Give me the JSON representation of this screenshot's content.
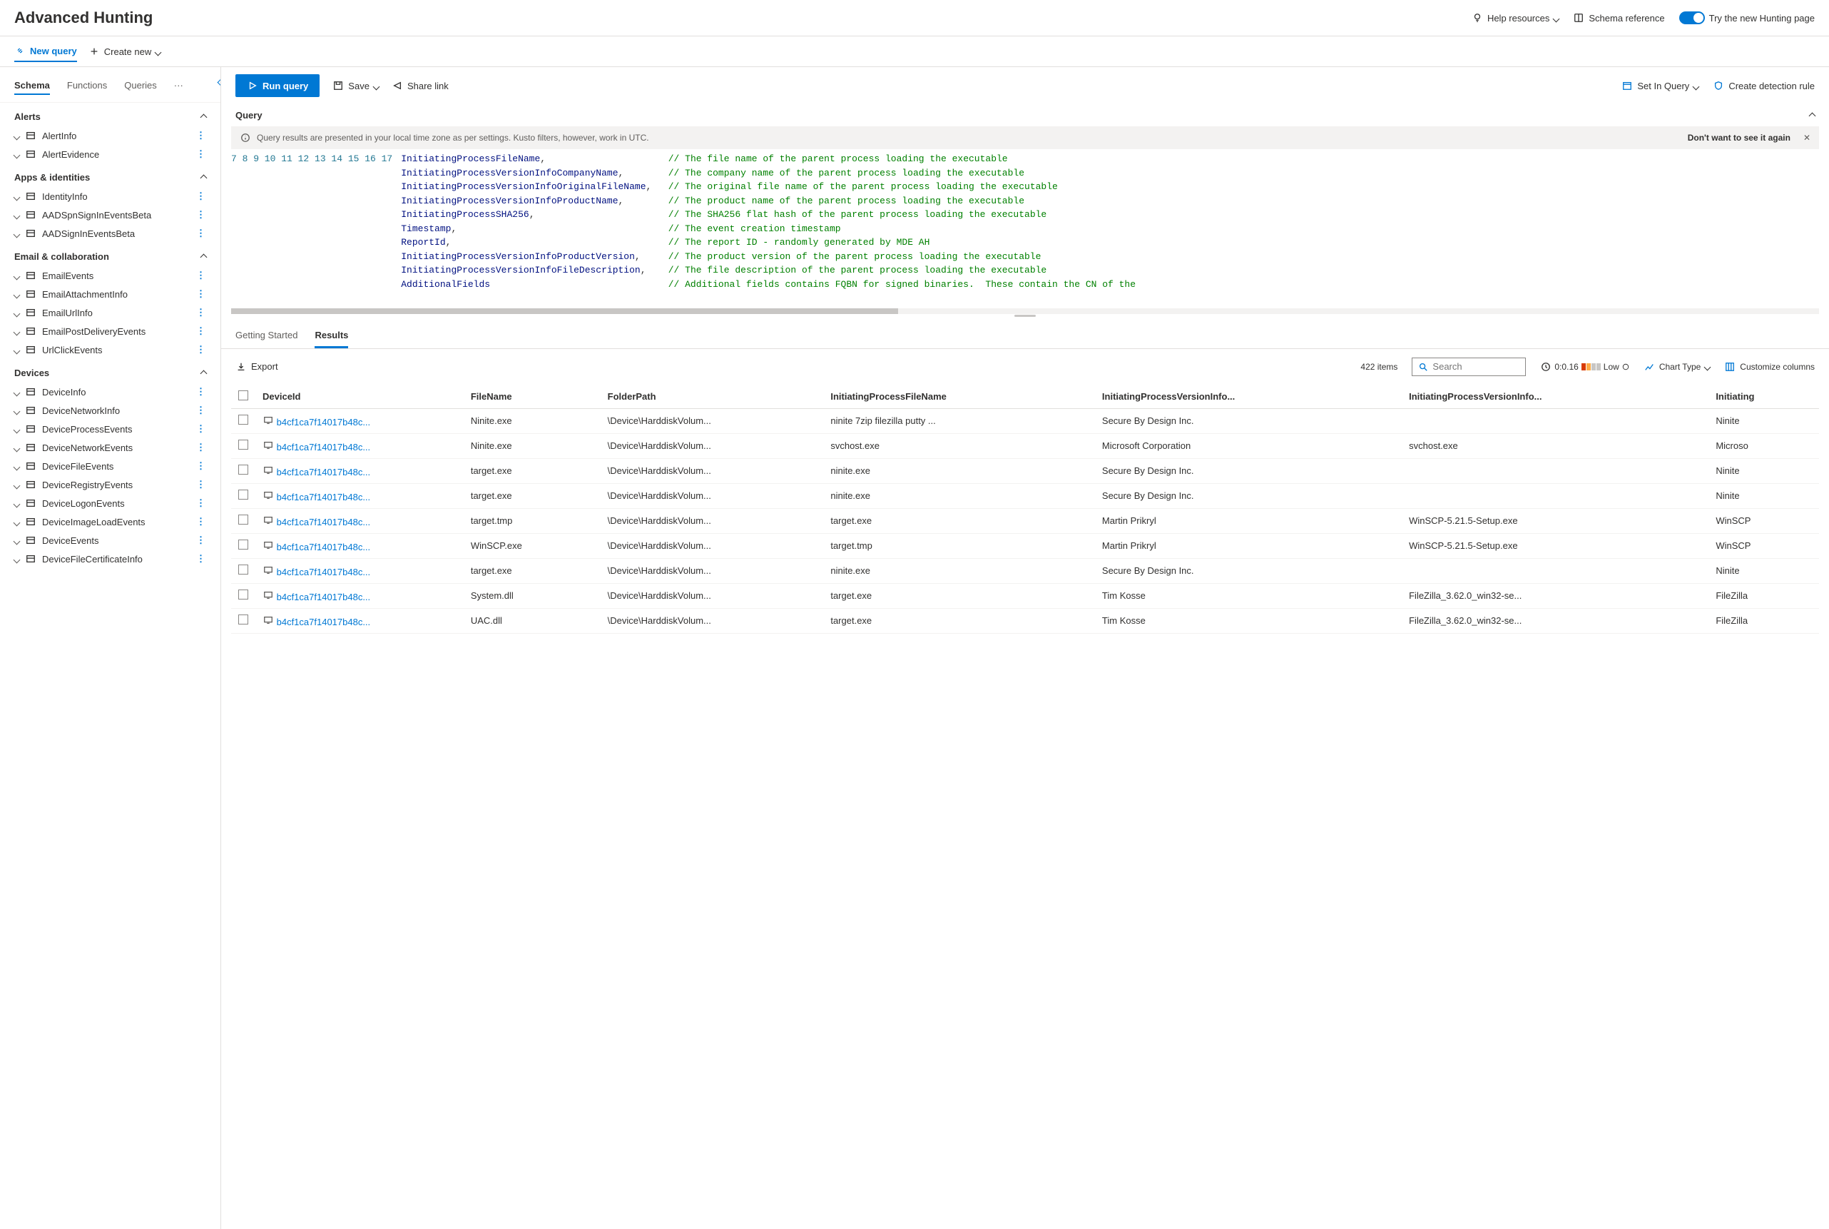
{
  "header": {
    "title": "Advanced Hunting",
    "help": "Help resources",
    "schema_ref": "Schema reference",
    "toggle_label": "Try the new Hunting page"
  },
  "query_tabs": {
    "new_query": "New query",
    "create_new": "Create new"
  },
  "sidebar": {
    "tabs": [
      "Schema",
      "Functions",
      "Queries"
    ],
    "sections": [
      {
        "title": "Alerts",
        "items": [
          "AlertInfo",
          "AlertEvidence"
        ]
      },
      {
        "title": "Apps & identities",
        "items": [
          "IdentityInfo",
          "AADSpnSignInEventsBeta",
          "AADSignInEventsBeta"
        ]
      },
      {
        "title": "Email & collaboration",
        "items": [
          "EmailEvents",
          "EmailAttachmentInfo",
          "EmailUrlInfo",
          "EmailPostDeliveryEvents",
          "UrlClickEvents"
        ]
      },
      {
        "title": "Devices",
        "items": [
          "DeviceInfo",
          "DeviceNetworkInfo",
          "DeviceProcessEvents",
          "DeviceNetworkEvents",
          "DeviceFileEvents",
          "DeviceRegistryEvents",
          "DeviceLogonEvents",
          "DeviceImageLoadEvents",
          "DeviceEvents",
          "DeviceFileCertificateInfo"
        ]
      }
    ]
  },
  "actions": {
    "run": "Run query",
    "save": "Save",
    "share": "Share link",
    "set_in_query": "Set In Query",
    "create_rule": "Create detection rule"
  },
  "query_label": "Query",
  "banner": {
    "text": "Query results are presented in your local time zone as per settings. Kusto filters, however, work in UTC.",
    "dismiss": "Don't want to see it again"
  },
  "code": [
    {
      "n": 7,
      "id": "InitiatingProcessFileName",
      "comma": ",",
      "cm": "// The file name of the parent process loading the executable"
    },
    {
      "n": 8,
      "id": "InitiatingProcessVersionInfoCompanyName",
      "comma": ",",
      "cm": "// The company name of the parent process loading the executable"
    },
    {
      "n": 9,
      "id": "InitiatingProcessVersionInfoOriginalFileName",
      "comma": ",",
      "cm": "// The original file name of the parent process loading the executable"
    },
    {
      "n": 10,
      "id": "InitiatingProcessVersionInfoProductName",
      "comma": ",",
      "cm": "// The product name of the parent process loading the executable"
    },
    {
      "n": 11,
      "id": "InitiatingProcessSHA256",
      "comma": ",",
      "cm": "// The SHA256 flat hash of the parent process loading the executable"
    },
    {
      "n": 12,
      "id": "Timestamp",
      "comma": ",",
      "cm": "// The event creation timestamp"
    },
    {
      "n": 13,
      "id": "ReportId",
      "comma": ",",
      "cm": "// The report ID - randomly generated by MDE AH"
    },
    {
      "n": 14,
      "id": "InitiatingProcessVersionInfoProductVersion",
      "comma": ",",
      "cm": "// The product version of the parent process loading the executable"
    },
    {
      "n": 15,
      "id": "InitiatingProcessVersionInfoFileDescription",
      "comma": ",",
      "cm": "// The file description of the parent process loading the executable"
    },
    {
      "n": 16,
      "id": "AdditionalFields",
      "comma": "",
      "cm": "// Additional fields contains FQBN for signed binaries.  These contain the CN of the"
    },
    {
      "n": 17,
      "id": "",
      "comma": "",
      "cm": ""
    }
  ],
  "results": {
    "tabs": [
      "Getting Started",
      "Results"
    ],
    "export": "Export",
    "count": "422 items",
    "search_ph": "Search",
    "time": "0:0.16",
    "perf": "Low",
    "chart": "Chart Type",
    "customize": "Customize columns",
    "columns": [
      "DeviceId",
      "FileName",
      "FolderPath",
      "InitiatingProcessFileName",
      "InitiatingProcessVersionInfo...",
      "InitiatingProcessVersionInfo...",
      "Initiating"
    ],
    "rows": [
      {
        "d": "b4cf1ca7f14017b48c...",
        "f": "Ninite.exe",
        "p": "\\Device\\HarddiskVolum...",
        "i": "ninite 7zip filezilla putty ...",
        "c": "Secure By Design Inc.",
        "o": "",
        "l": "Ninite"
      },
      {
        "d": "b4cf1ca7f14017b48c...",
        "f": "Ninite.exe",
        "p": "\\Device\\HarddiskVolum...",
        "i": "svchost.exe",
        "c": "Microsoft Corporation",
        "o": "svchost.exe",
        "l": "Microso"
      },
      {
        "d": "b4cf1ca7f14017b48c...",
        "f": "target.exe",
        "p": "\\Device\\HarddiskVolum...",
        "i": "ninite.exe",
        "c": "Secure By Design Inc.",
        "o": "",
        "l": "Ninite"
      },
      {
        "d": "b4cf1ca7f14017b48c...",
        "f": "target.exe",
        "p": "\\Device\\HarddiskVolum...",
        "i": "ninite.exe",
        "c": "Secure By Design Inc.",
        "o": "",
        "l": "Ninite"
      },
      {
        "d": "b4cf1ca7f14017b48c...",
        "f": "target.tmp",
        "p": "\\Device\\HarddiskVolum...",
        "i": "target.exe",
        "c": "Martin Prikryl",
        "o": "WinSCP-5.21.5-Setup.exe",
        "l": "WinSCP"
      },
      {
        "d": "b4cf1ca7f14017b48c...",
        "f": "WinSCP.exe",
        "p": "\\Device\\HarddiskVolum...",
        "i": "target.tmp",
        "c": "Martin Prikryl",
        "o": "WinSCP-5.21.5-Setup.exe",
        "l": "WinSCP"
      },
      {
        "d": "b4cf1ca7f14017b48c...",
        "f": "target.exe",
        "p": "\\Device\\HarddiskVolum...",
        "i": "ninite.exe",
        "c": "Secure By Design Inc.",
        "o": "",
        "l": "Ninite"
      },
      {
        "d": "b4cf1ca7f14017b48c...",
        "f": "System.dll",
        "p": "\\Device\\HarddiskVolum...",
        "i": "target.exe",
        "c": "Tim Kosse",
        "o": "FileZilla_3.62.0_win32-se...",
        "l": "FileZilla"
      },
      {
        "d": "b4cf1ca7f14017b48c...",
        "f": "UAC.dll",
        "p": "\\Device\\HarddiskVolum...",
        "i": "target.exe",
        "c": "Tim Kosse",
        "o": "FileZilla_3.62.0_win32-se...",
        "l": "FileZilla"
      }
    ]
  }
}
